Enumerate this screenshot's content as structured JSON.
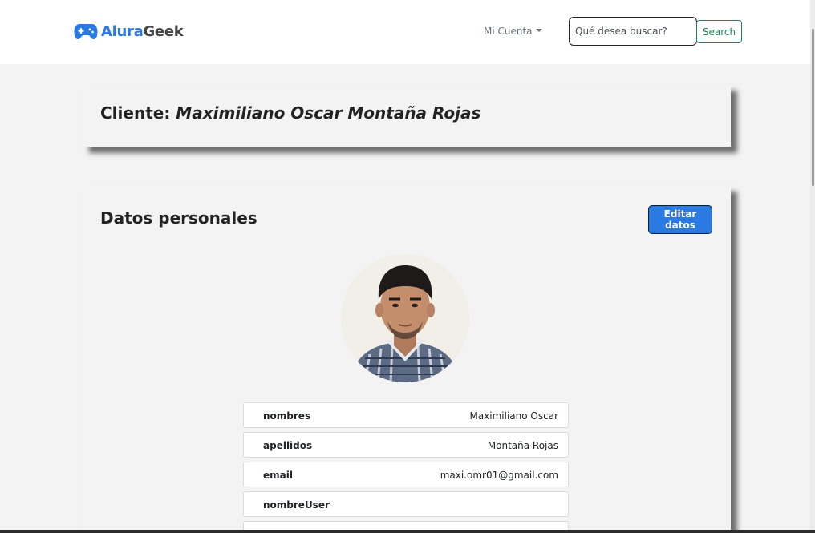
{
  "brand": {
    "part1": "Alura",
    "part2": "Geek",
    "icon": "gamepad-icon",
    "color": "#2a7ae4"
  },
  "nav": {
    "account_label": "Mi Cuenta",
    "search_placeholder": "Qué desea buscar?",
    "search_value": "",
    "search_button": "Search"
  },
  "client": {
    "prefix": "Cliente:",
    "name": "Maximiliano Oscar Montaña Rojas"
  },
  "personal": {
    "title": "Datos personales",
    "edit_button": "Editar datos",
    "avatar": "profile-photo",
    "fields": [
      {
        "label": "nombres",
        "value": "Maximiliano Oscar"
      },
      {
        "label": "apellidos",
        "value": "Montaña Rojas"
      },
      {
        "label": "email",
        "value": "maxi.omr01@gmail.com"
      },
      {
        "label": "nombreUser",
        "value": ""
      }
    ]
  },
  "colors": {
    "accent": "#2a7ae4",
    "success": "#198754",
    "page_bg": "#f3f3f3"
  }
}
